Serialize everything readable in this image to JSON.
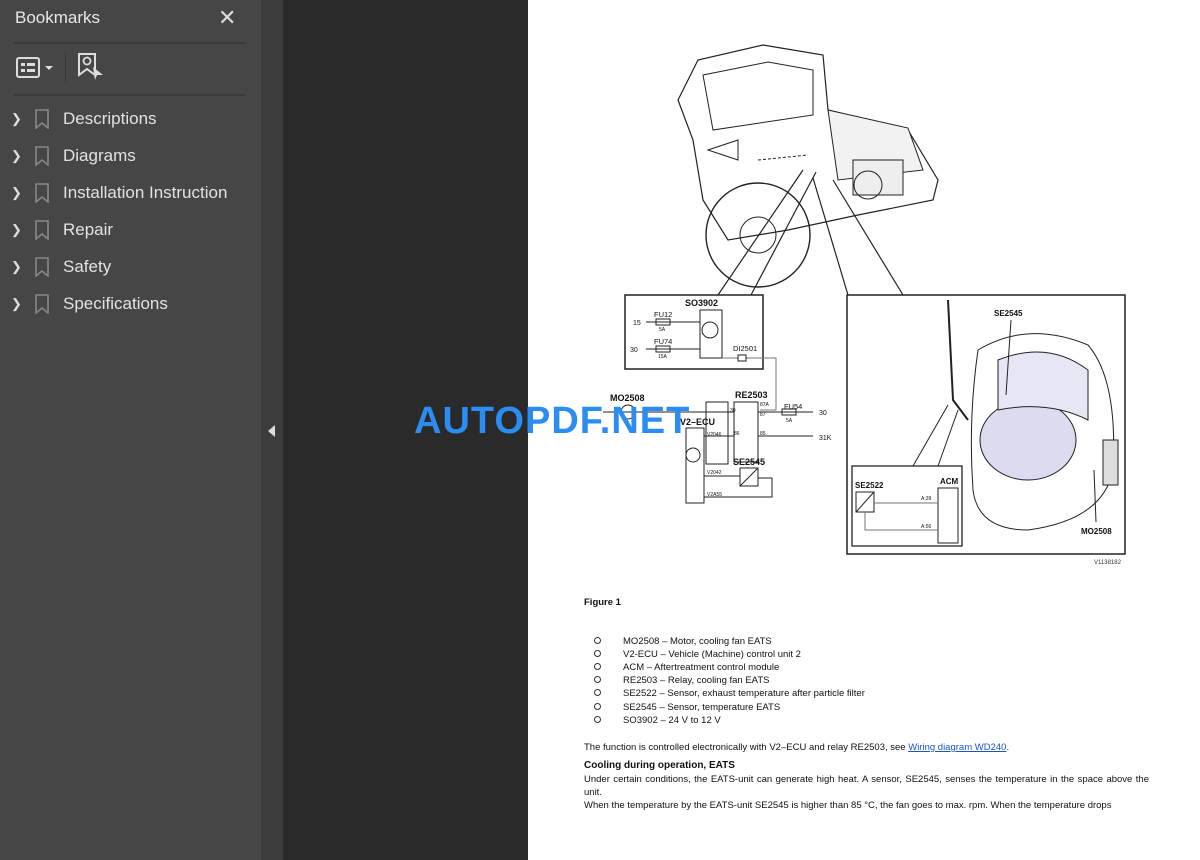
{
  "sidebar": {
    "title": "Bookmarks",
    "close_icon": "close-icon",
    "toolbar": {
      "options_icon": "list-options-icon",
      "find_icon": "find-bookmark-icon"
    },
    "items": [
      {
        "label": "Descriptions"
      },
      {
        "label": "Diagrams"
      },
      {
        "label": "Installation Instruction"
      },
      {
        "label": "Repair"
      },
      {
        "label": "Safety"
      },
      {
        "label": "Specifications"
      }
    ]
  },
  "watermark": "AUTOPDF.NET",
  "figure": {
    "so3902": "SO3902",
    "fu12": "FU12",
    "fu12_a": "5A",
    "fu74": "FU74",
    "fu74_a": "15A",
    "pin15": "15",
    "pin30": "30",
    "di2501": "DI2501",
    "mo2508": "MO2508",
    "re2503": "RE2503",
    "fu54": "FU54",
    "fu54_a": "5A",
    "out30": "30",
    "out31k": "31K",
    "v2ecu": "V2–ECU",
    "v2046": "V2046",
    "v2042": "V2042",
    "v2a55": "V2A55",
    "se2545": "SE2545",
    "p30": "30",
    "p87a": "87A",
    "p87": "87",
    "p86": "86",
    "p85": "85",
    "se2545_r": "SE2545",
    "se2522": "SE2522",
    "acm": "ACM",
    "a39": "A:39",
    "a56": "A:56",
    "mo2508_r": "MO2508",
    "ref": "V1138182"
  },
  "content": {
    "figure_caption": "Figure 1",
    "list": [
      "MO2508 – Motor, cooling fan EATS",
      "V2-ECU – Vehicle (Machine) control unit 2",
      "ACM – Aftertreatment control module",
      "RE2503 – Relay, cooling fan EATS",
      "SE2522 – Sensor, exhaust temperature after particle filter",
      "SE2545 – Sensor, temperature EATS",
      "SO3902 – 24 V to 12 V"
    ],
    "p1_text": "The function is controlled electronically with V2–ECU and relay RE2503, see ",
    "p1_link": "Wiring diagram WD240",
    "p1_end": ".",
    "heading": "Cooling during operation, EATS",
    "p2": "Under certain conditions, the EATS-unit can generate high heat. A sensor, SE2545, senses the temperature in the space above the unit.",
    "p3": "When the temperature by the EATS-unit SE2545 is higher than 85 °C, the fan goes to max. rpm. When the temperature drops"
  }
}
